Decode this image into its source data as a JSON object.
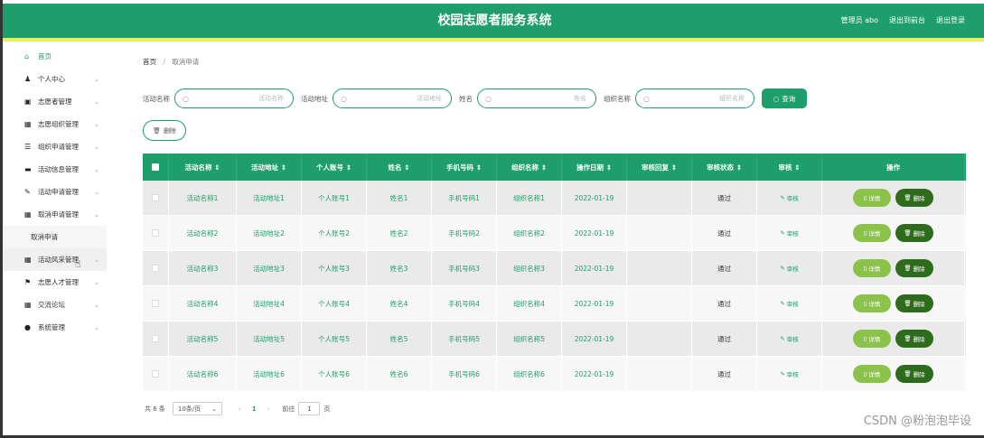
{
  "header": {
    "title": "校园志愿者服务系统",
    "user": "管理员 abo",
    "back_link": "退出到前台",
    "logout_link": "退出登录"
  },
  "sidebar": {
    "items": [
      {
        "label": "首页",
        "icon": "home-icon",
        "glyph": "⌂"
      },
      {
        "label": "个人中心",
        "icon": "user-icon",
        "glyph": "♟"
      },
      {
        "label": "志愿者管理",
        "icon": "volunteer-icon",
        "glyph": "▣"
      },
      {
        "label": "志愿组织管理",
        "icon": "grid-icon",
        "glyph": "▦"
      },
      {
        "label": "组织申请管理",
        "icon": "list-icon",
        "glyph": "☰"
      },
      {
        "label": "活动信息管理",
        "icon": "film-icon",
        "glyph": "▬"
      },
      {
        "label": "活动申请管理",
        "icon": "thumb-icon",
        "glyph": "✎"
      },
      {
        "label": "取消申请管理",
        "icon": "apps-icon",
        "glyph": "▦"
      },
      {
        "label": "取消申请",
        "icon": "",
        "glyph": ""
      },
      {
        "label": "活动风采管理",
        "icon": "apps-icon",
        "glyph": "▦"
      },
      {
        "label": "志愿人才管理",
        "icon": "flag-icon",
        "glyph": "⚑"
      },
      {
        "label": "交流论坛",
        "icon": "apps-icon",
        "glyph": "▦"
      },
      {
        "label": "系统管理",
        "icon": "location-icon",
        "glyph": "●"
      }
    ]
  },
  "breadcrumb": {
    "home": "首页",
    "sep": "/",
    "current": "取消申请"
  },
  "search": {
    "fields": [
      {
        "label": "活动名称",
        "placeholder": "活动名称"
      },
      {
        "label": "活动地址",
        "placeholder": "活动地址"
      },
      {
        "label": "姓名",
        "placeholder": "姓名"
      },
      {
        "label": "组织名称",
        "placeholder": "组织名称"
      }
    ],
    "button": "查询"
  },
  "toolbar": {
    "delete": "删除"
  },
  "table": {
    "headers": [
      "活动名称 ⇕",
      "活动地址 ⇕",
      "个人账号 ⇕",
      "姓名 ⇕",
      "手机号码 ⇕",
      "组织名称 ⇕",
      "操作日期 ⇕",
      "审核回复 ⇕",
      "审核状态 ⇕",
      "审核 ⇕",
      "操作"
    ],
    "rows": [
      [
        "活动名称1",
        "活动地址1",
        "个人账号1",
        "姓名1",
        "手机号码1",
        "组织名称1",
        "2022-01-19",
        "",
        "通过",
        "审核"
      ],
      [
        "活动名称2",
        "活动地址2",
        "个人账号2",
        "姓名2",
        "手机号码2",
        "组织名称2",
        "2022-01-19",
        "",
        "通过",
        "审核"
      ],
      [
        "活动名称3",
        "活动地址3",
        "个人账号3",
        "姓名3",
        "手机号码3",
        "组织名称3",
        "2022-01-19",
        "",
        "通过",
        "审核"
      ],
      [
        "活动名称4",
        "活动地址4",
        "个人账号4",
        "姓名4",
        "手机号码4",
        "组织名称4",
        "2022-01-19",
        "",
        "通过",
        "审核"
      ],
      [
        "活动名称5",
        "活动地址5",
        "个人账号5",
        "姓名5",
        "手机号码5",
        "组织名称5",
        "2022-01-19",
        "",
        "通过",
        "审核"
      ],
      [
        "活动名称6",
        "活动地址6",
        "个人账号6",
        "姓名6",
        "手机号码6",
        "组织名称6",
        "2022-01-19",
        "",
        "通过",
        "审核"
      ]
    ],
    "detail_button": "详情",
    "delete_button": "删除"
  },
  "pagination": {
    "total": "共 6 条",
    "page_size": "10条/页",
    "current_page": "1",
    "goto_prefix": "前往",
    "goto_value": "1",
    "goto_suffix": "页"
  },
  "watermark": "CSDN @粉泡泡毕设",
  "colors": {
    "primary": "#1d9e6a",
    "accent_line": "#e7f15c",
    "detail_btn": "#8bc34a",
    "delete_btn": "#2e6b1d"
  }
}
